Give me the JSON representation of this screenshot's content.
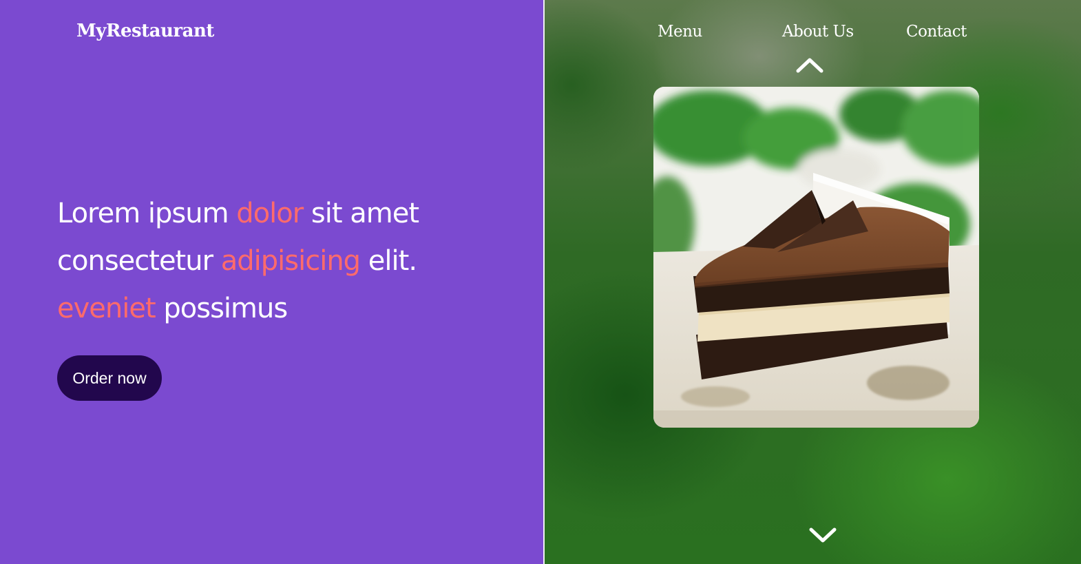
{
  "brand": {
    "name": "MyRestaurant"
  },
  "hero": {
    "segments": [
      {
        "text": "Lorem ipsum ",
        "accent": false
      },
      {
        "text": "dolor",
        "accent": true
      },
      {
        "text": " sit amet consectetur ",
        "accent": false
      },
      {
        "text": "adipisicing",
        "accent": true
      },
      {
        "text": " elit. ",
        "accent": false
      },
      {
        "text": "eveniet",
        "accent": true
      },
      {
        "text": " possimus",
        "accent": false
      }
    ],
    "parts": {
      "p1": "Lorem ipsum ",
      "p2": "dolor",
      "p3": " sit amet consectetur ",
      "p4": "adipisicing",
      "p5": " elit. ",
      "p6": "eveniet",
      "p7": " possimus"
    }
  },
  "cta": {
    "order_label": "Order now"
  },
  "nav": {
    "items": [
      {
        "label": "Menu"
      },
      {
        "label": "About Us"
      },
      {
        "label": "Contact"
      }
    ]
  },
  "carousel": {
    "up_icon": "chevron-up-icon",
    "down_icon": "chevron-down-icon",
    "image_subject": "chocolate-layer-cake-slice"
  },
  "colors": {
    "left_background": "#7b4ad0",
    "accent_text": "#ff6b6b",
    "button_background": "#22074d",
    "text": "#ffffff"
  }
}
